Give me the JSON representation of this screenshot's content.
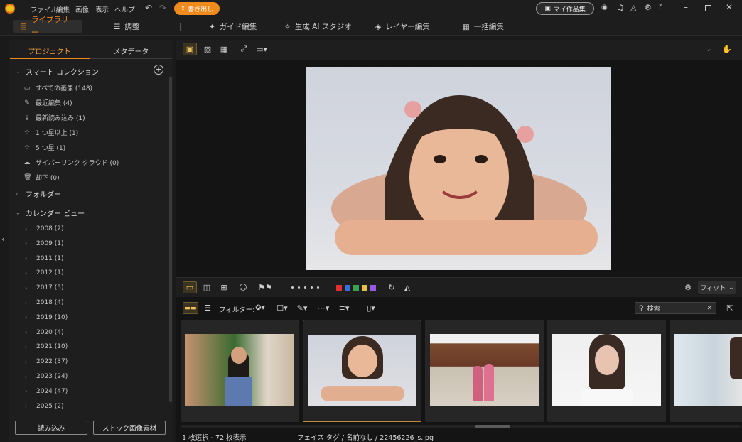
{
  "menu": [
    "ファイル",
    "編集",
    "画像",
    "表示",
    "ヘルプ"
  ],
  "export_label": "書き出し",
  "my_works_label": "マイ作品集",
  "tabs": [
    "ライブラリー",
    "調整",
    "ガイド編集",
    "生成 AI スタジオ",
    "レイヤー編集",
    "一括編集"
  ],
  "sidebar": {
    "tabs": [
      "プロジェクト",
      "メタデータ"
    ],
    "smart_collection": "スマート コレクション",
    "collections": [
      {
        "label": "すべての画像 (148)",
        "icon": "images-icon"
      },
      {
        "label": "最近編集 (4)",
        "icon": "pencil-icon"
      },
      {
        "label": "最新読み込み (1)",
        "icon": "download-icon"
      },
      {
        "label": "1 つ星以上 (1)",
        "icon": "star-icon"
      },
      {
        "label": "5 つ星 (1)",
        "icon": "star-icon"
      },
      {
        "label": "サイバーリンク クラウド (0)",
        "icon": "cloud-icon"
      },
      {
        "label": "却下 (0)",
        "icon": "trash-icon"
      }
    ],
    "folders": "フォルダー",
    "calendar": "カレンダー ビュー",
    "years": [
      "2008 (2)",
      "2009 (1)",
      "2011 (1)",
      "2012 (1)",
      "2017 (5)",
      "2018 (4)",
      "2019 (10)",
      "2020 (4)",
      "2021 (10)",
      "2022 (37)",
      "2023 (24)",
      "2024 (47)",
      "2025 (2)"
    ],
    "import_label": "読み込み",
    "stock_label": "ストック画像素材"
  },
  "fit_label": "フィット",
  "filter_label": "フィルター:",
  "search_placeholder": "検索",
  "status": {
    "selection": "1 枚選択 - 72 枚表示",
    "path": "フェイス タグ / 名前なし / 22456226_s.jpg"
  },
  "color_labels": [
    "#e0302b",
    "#3a6fe0",
    "#3aa24a",
    "#e8c04a",
    "#9a5ae0"
  ]
}
